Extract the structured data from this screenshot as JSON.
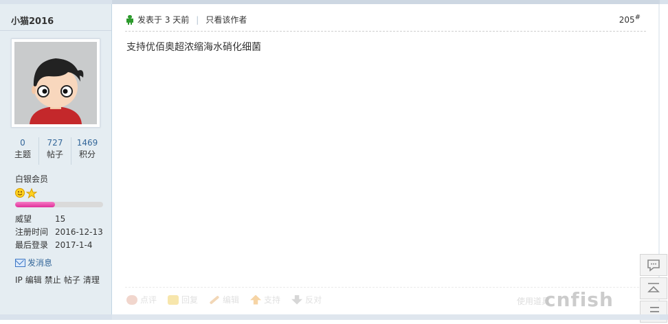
{
  "user": {
    "name": "小猫2016",
    "stats": [
      {
        "value": "0",
        "label": "主题"
      },
      {
        "value": "727",
        "label": "帖子"
      },
      {
        "value": "1469",
        "label": "积分"
      }
    ],
    "group": "白银会员",
    "level_progress_percent": 45,
    "info": [
      {
        "key": "威望",
        "value": "15"
      },
      {
        "key": "注册时间",
        "value": "2016-12-13"
      },
      {
        "key": "最后登录",
        "value": "2017-1-4"
      }
    ],
    "send_message": "发消息",
    "admin_links": [
      "IP",
      "编辑",
      "禁止",
      "帖子",
      "清理"
    ]
  },
  "post": {
    "posted": "发表于 3 天前",
    "only_author": "只看该作者",
    "floor": "205",
    "floor_mark": "#",
    "content": "支持优佰奥超浓缩海水硝化细菌"
  },
  "actions": {
    "rate": "点评",
    "reply": "回复",
    "edit": "编辑",
    "support": "支持",
    "oppose": "反对",
    "tools": "使用道具"
  },
  "watermark": "cnfish",
  "colors": {
    "accent": "#336699",
    "sidebar_bg": "#e5edf2",
    "progress": "#e0309a",
    "user_icon": "#2d9a2d"
  },
  "icons": [
    "user-icon",
    "mail-icon",
    "smile-icon",
    "star-icon",
    "comment-icon",
    "top-icon",
    "list-icon"
  ]
}
